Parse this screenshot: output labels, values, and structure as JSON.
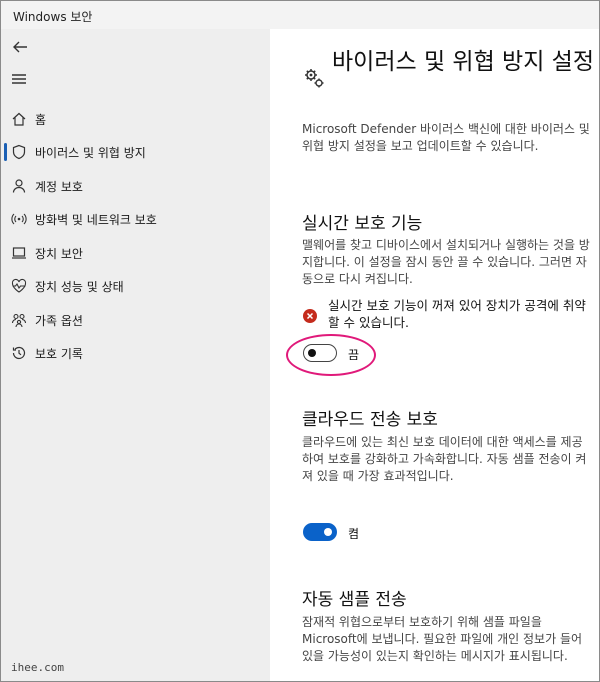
{
  "window": {
    "title": "Windows 보안"
  },
  "sidebar": {
    "items": [
      {
        "label": "홈",
        "icon": "home-icon"
      },
      {
        "label": "바이러스 및 위협 방지",
        "icon": "shield-icon",
        "active": true
      },
      {
        "label": "계정 보호",
        "icon": "person-icon"
      },
      {
        "label": "방화벽 및 네트워크 보호",
        "icon": "wireless-icon"
      },
      {
        "label": "장치 보안",
        "icon": "laptop-icon"
      },
      {
        "label": "장치 성능 및 상태",
        "icon": "heart-pulse-icon"
      },
      {
        "label": "가족 옵션",
        "icon": "family-icon"
      },
      {
        "label": "보호 기록",
        "icon": "history-icon"
      }
    ],
    "watermark": "ihee.com"
  },
  "main": {
    "title": "바이러스 및 위협 방지 설정",
    "description": "Microsoft Defender 바이러스 백신에 대한 바이러스 및 위협 방지 설정을 보고 업데이트할 수 있습니다.",
    "sections": [
      {
        "heading": "실시간 보호 기능",
        "description": "맬웨어를 찾고 디바이스에서 설치되거나 실행하는 것을 방지합니다. 이 설정을 잠시 동안 끌 수 있습니다. 그러면 자동으로 다시 켜집니다.",
        "warning": "실시간 보호 기능이 꺼져 있어 장치가 공격에 취약할 수 있습니다.",
        "toggle_state": "off",
        "toggle_label": "끔"
      },
      {
        "heading": "클라우드 전송 보호",
        "description": "클라우드에 있는 최신 보호 데이터에 대한 액세스를 제공하여 보호를 강화하고 가속화합니다. 자동 샘플 전송이 켜져 있을 때 가장 효과적입니다.",
        "toggle_state": "on",
        "toggle_label": "켬"
      },
      {
        "heading": "자동 샘플 전송",
        "description": "잠재적 위협으로부터 보호하기 위해 샘플 파일을 Microsoft에 보냅니다. 필요한 파일에 개인 정보가 들어 있을 가능성이 있는지 확인하는 메시지가 표시됩니다."
      }
    ]
  },
  "colors": {
    "accent": "#0a62c9",
    "error": "#c42b1c",
    "highlight": "#e0197a"
  }
}
